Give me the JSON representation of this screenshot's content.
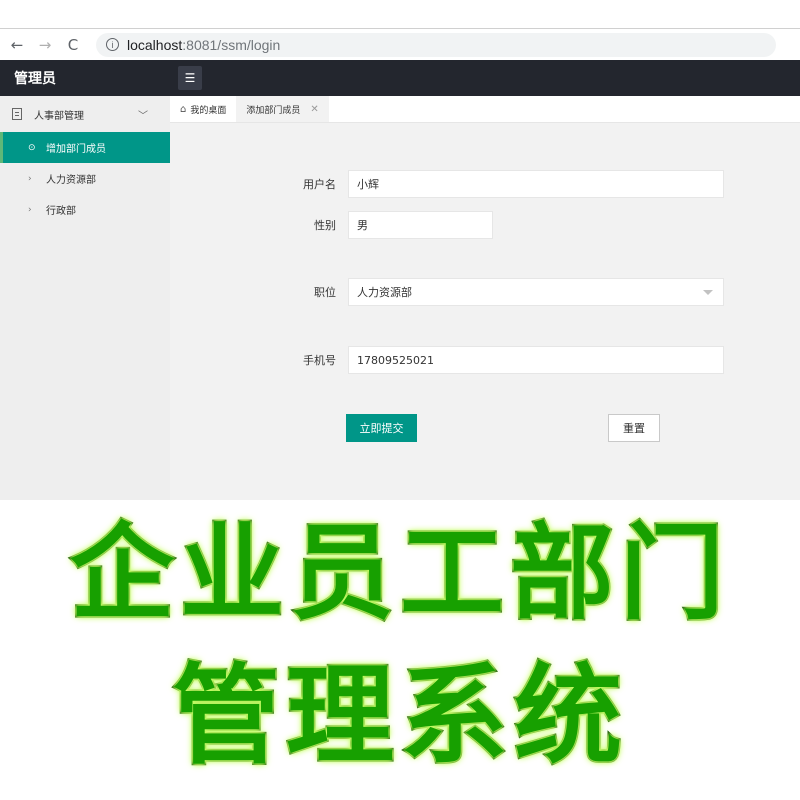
{
  "browser": {
    "url_host": "localhost",
    "url_path": ":8081/ssm/login",
    "back_icon": "back-arrow-icon",
    "forward_icon": "forward-arrow-icon",
    "reload_icon": "reload-icon",
    "info_icon": "info-icon"
  },
  "header": {
    "title": "管理员",
    "menu_icon": "list-icon"
  },
  "sidebar": {
    "group_label": "人事部管理",
    "items": [
      {
        "label": "增加部门成员",
        "active": true
      },
      {
        "label": "人力资源部",
        "active": false
      },
      {
        "label": "行政部",
        "active": false
      }
    ]
  },
  "tabs": [
    {
      "label": "我的桌面",
      "icon": "home-icon"
    },
    {
      "label": "添加部门成员",
      "icon": "close-icon"
    }
  ],
  "form": {
    "username_label": "用户名",
    "username_value": "小辉",
    "gender_label": "性别",
    "gender_value": "男",
    "position_label": "职位",
    "position_value": "人力资源部",
    "phone_label": "手机号",
    "phone_value": "17809525021",
    "submit_label": "立即提交",
    "reset_label": "重置"
  },
  "banner": {
    "line1": "企业员工部门",
    "line2": "管理系统"
  },
  "colors": {
    "accent": "#009688",
    "header_bg": "#23262e",
    "banner_text": "#17a000"
  }
}
